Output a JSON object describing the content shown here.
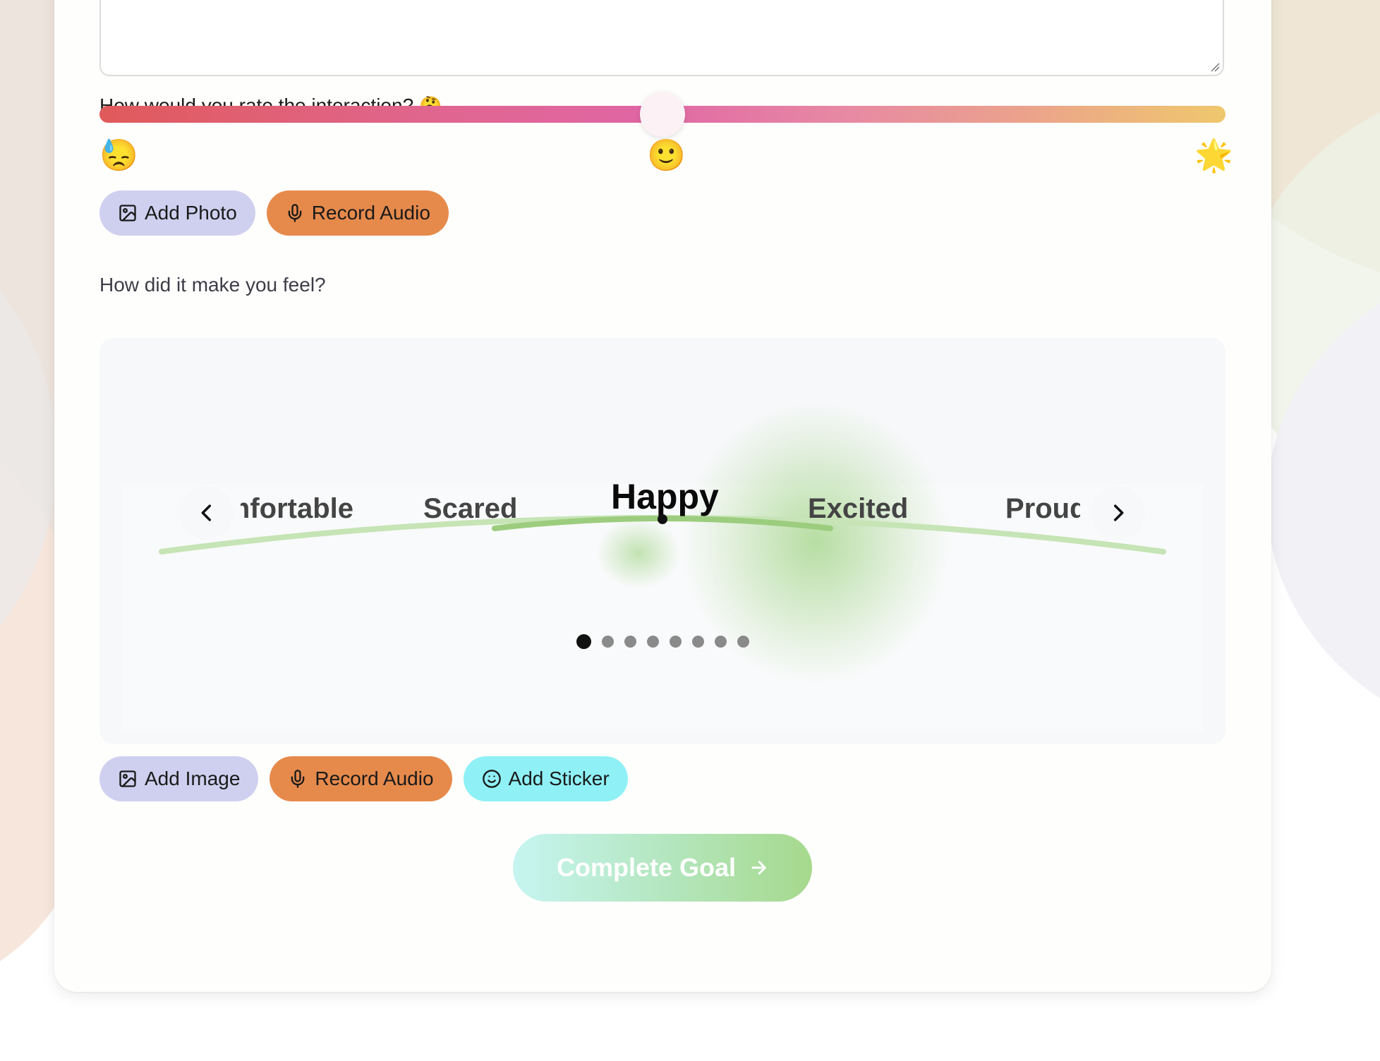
{
  "rating": {
    "question": "How would you rate the interaction?",
    "question_emoji": "🤔",
    "value_percent": 50,
    "scale_emojis": {
      "low": "😓",
      "mid": "🙂",
      "high": "🌟"
    }
  },
  "rating_actions": {
    "add_photo": "Add Photo",
    "record_audio": "Record Audio"
  },
  "feelings": {
    "question": "How did it make you feel?",
    "words": [
      "Uncomfortable",
      "Scared",
      "Happy",
      "Excited",
      "Proud"
    ],
    "selected": "Happy",
    "page_count": 8,
    "active_page": 1,
    "accent_color": "#80c65a"
  },
  "feeling_actions": {
    "add_image": "Add Image",
    "record_audio": "Record Audio",
    "add_sticker": "Add Sticker"
  },
  "footer": {
    "complete_label": "Complete Goal"
  },
  "colors": {
    "photo_button": "#cfd0ef",
    "audio_button": "#e68a4c",
    "sticker_button": "#8ff1f6"
  }
}
